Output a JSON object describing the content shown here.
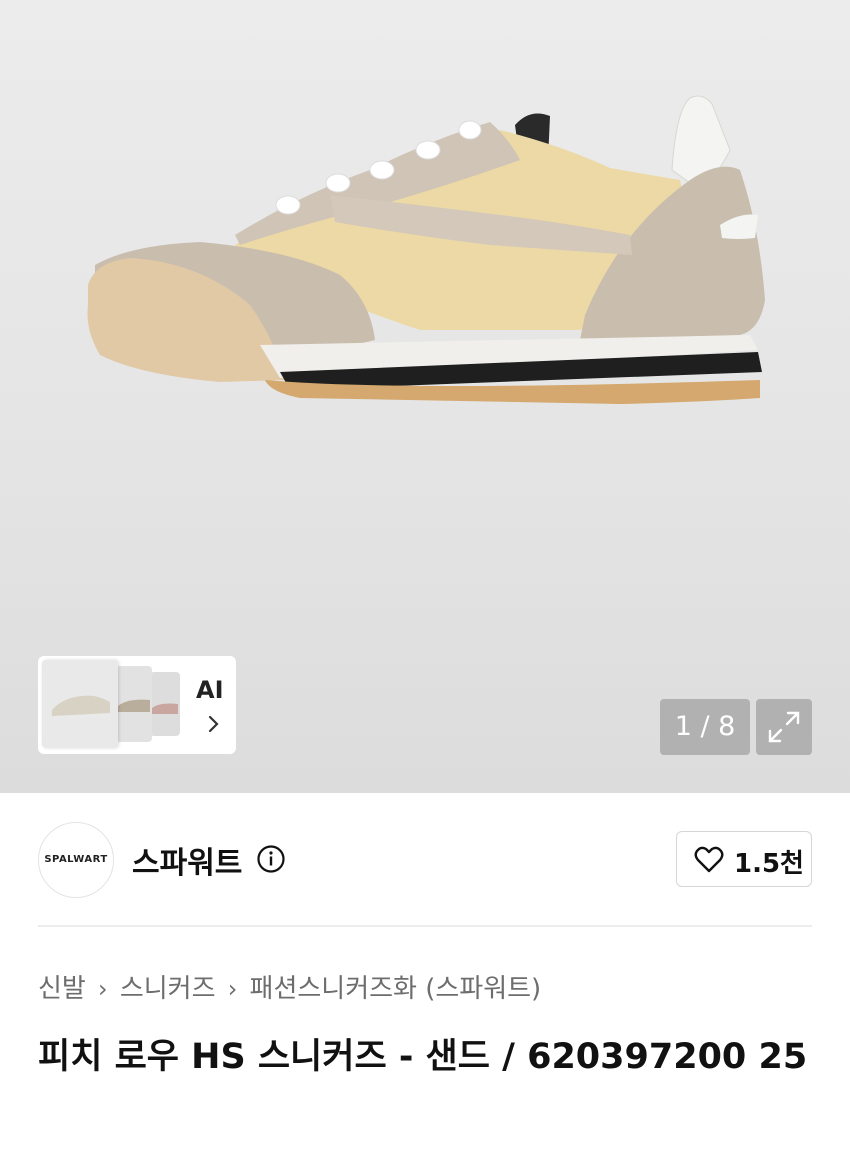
{
  "gallery": {
    "ai_label": "AI",
    "pager": "1 / 8",
    "main_image_icon": "sneaker-product-image",
    "expand_icon": "expand-icon"
  },
  "brand": {
    "logo_text": "SPALWART",
    "name": "스파워트",
    "like_count": "1.5천"
  },
  "breadcrumb": {
    "items": [
      "신발",
      "스니커즈",
      "패션스니커즈화 (스파워트)"
    ]
  },
  "product": {
    "title": "피치 로우 HS 스니커즈 - 샌드 / 620397200 25"
  },
  "colors": {
    "suede": "#cfc4b6",
    "nylon": "#ecd9a5",
    "sole_gum": "#e1c9a6"
  }
}
